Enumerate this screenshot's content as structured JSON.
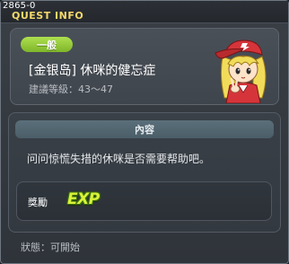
{
  "window": {
    "id_label": "2865-0",
    "title": "QUEST INFO"
  },
  "quest": {
    "category": "一般",
    "name": "[金银岛] 休咪的健忘症",
    "recommended_level": "建議等級：43～47"
  },
  "content": {
    "header": "內容",
    "description": "问问惊慌失措的休咪是否需要帮助吧。"
  },
  "reward": {
    "label": "獎勵",
    "exp_text": "EXP"
  },
  "status": {
    "text": "狀態：可開始"
  },
  "colors": {
    "title": "#f4d96a",
    "badge": "#8cc63a",
    "exp": "#d8f23a"
  },
  "icons": {
    "npc": "npc-portrait-red-cap-girl",
    "reward": "exp-icon"
  }
}
